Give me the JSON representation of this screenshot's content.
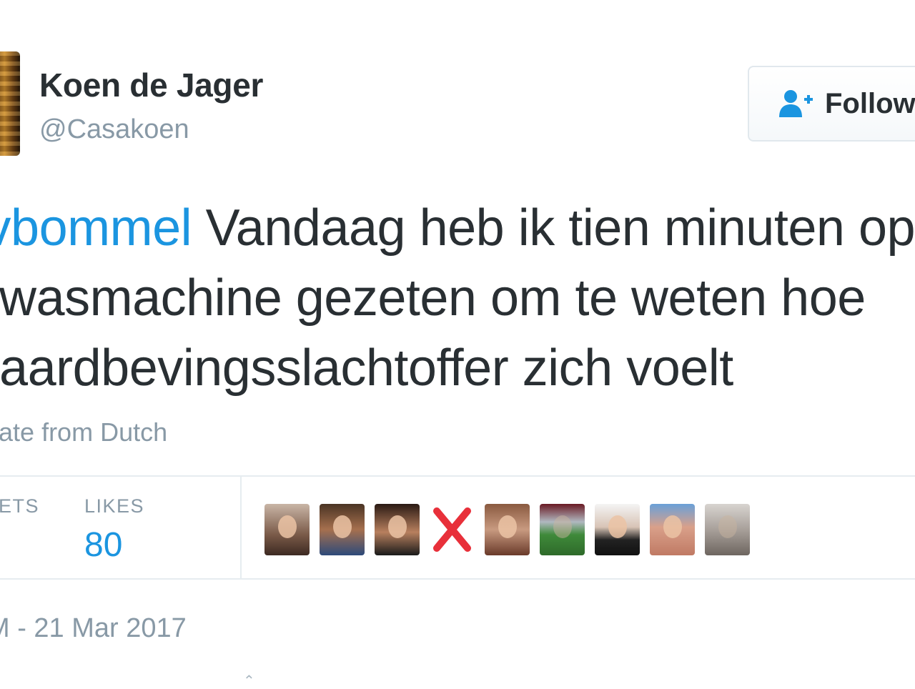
{
  "user": {
    "name": "Koen de Jager",
    "handle": "@Casakoen"
  },
  "follow_button": {
    "label": "Follow",
    "icon": "follow-user-icon"
  },
  "tweet": {
    "lines": [
      [
        "avbommel",
        " Vandaag heb ik tien minuten op"
      ],
      "n wasmachine gezeten om te weten hoe",
      "n aardbevingsslachtoffer zich voelt"
    ],
    "mention": "avbommel",
    "line1_rest": " Vandaag heb ik tien minuten op",
    "line2": "n wasmachine gezeten om te weten hoe",
    "line3": "n aardbevingsslachtoffer zich voelt",
    "translate_label": "nslate from Dutch"
  },
  "stats": {
    "retweets_label": "ETS",
    "likes_label": "LIKES",
    "likes_value": "80"
  },
  "likers": [
    {
      "icon": "liker-avatar"
    },
    {
      "icon": "liker-avatar"
    },
    {
      "icon": "liker-avatar"
    },
    {
      "icon": "red-x-icon"
    },
    {
      "icon": "liker-avatar"
    },
    {
      "icon": "liker-avatar"
    },
    {
      "icon": "liker-avatar"
    },
    {
      "icon": "liker-avatar"
    },
    {
      "icon": "liker-avatar"
    }
  ],
  "timestamp": "M - 21 Mar 2017",
  "colors": {
    "accent": "#1b95e0",
    "text": "#292f33",
    "muted": "#8899a6",
    "border": "#e6ecf0"
  }
}
